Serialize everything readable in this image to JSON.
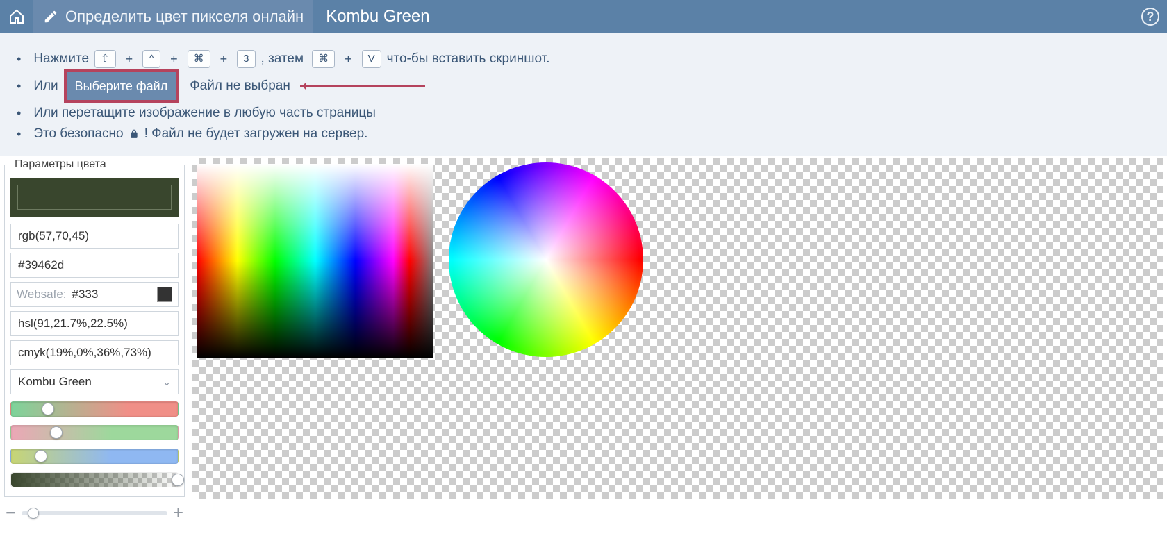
{
  "header": {
    "tool_title": "Определить цвет пикселя онлайн",
    "color_name": "Kombu Green"
  },
  "instructions": {
    "li1_prefix": "Нажмите",
    "key_shift": "⇧",
    "key_ctrl": "^",
    "key_cmd": "⌘",
    "key_3": "3",
    "then": ", затем",
    "key_cmd2": "⌘",
    "key_v": "V",
    "li1_suffix": "что-бы вставить скриншот.",
    "li2_prefix": "Или",
    "choose_file": "Выберите файл",
    "no_file": "Файл не выбран",
    "li3": "Или перетащите изображение в любую часть страницы",
    "li4_a": "Это безопасно ",
    "li4_b": "! Файл не будет загружен на сервер."
  },
  "panel": {
    "legend": "Параметры цвета",
    "swatch_color": "#39462d",
    "rgb": "rgb(57,70,45)",
    "hex": "#39462d",
    "websafe_label": "Websafe:",
    "websafe_value": "#333",
    "hsl": "hsl(91,21.7%,22.5%)",
    "cmyk": "cmyk(19%,0%,36%,73%)",
    "name_option": "Kombu Green",
    "slider_r_pct": 22,
    "slider_g_pct": 27,
    "slider_b_pct": 18,
    "slider_a_pct": 100
  },
  "zoom": {
    "value_pct": 8
  }
}
